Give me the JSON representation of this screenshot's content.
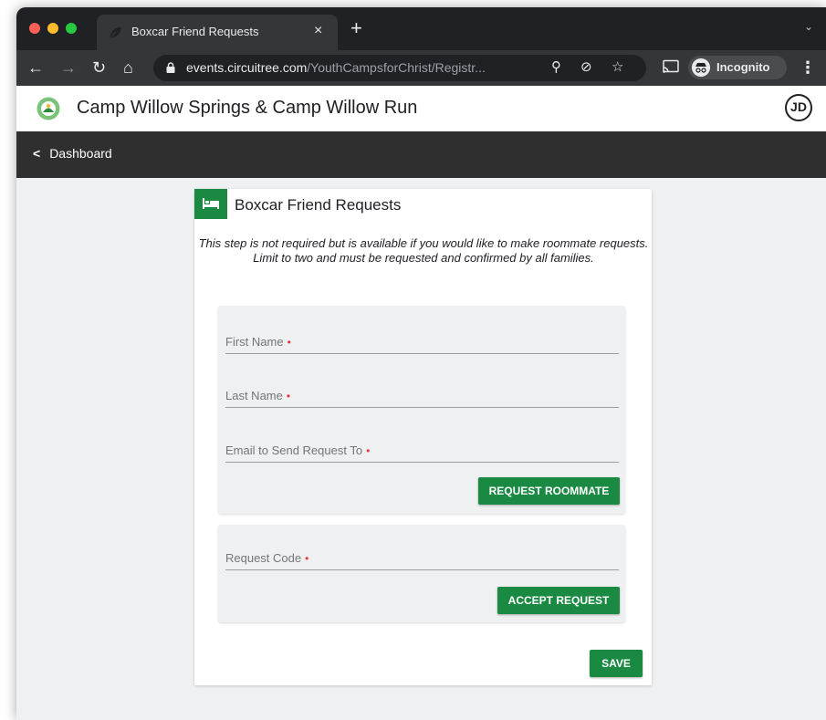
{
  "browser": {
    "tab_title": "Boxcar Friend Requests",
    "tab_close": "×",
    "new_tab": "+",
    "tab_search": "⌄",
    "url_host": "events.circuitree.com",
    "url_path": "/YouthCampsforChrist/Registr...",
    "incognito_label": "Incognito"
  },
  "app": {
    "title": "Camp Willow Springs & Camp Willow Run",
    "avatar_initials": "JD",
    "back_label": "Dashboard"
  },
  "card": {
    "title": "Boxcar Friend Requests",
    "description": "This step is not required but is available if you would like to make roommate requests. Limit to two and must be requested and confirmed by all families.",
    "fields": {
      "first_name": "First Name",
      "last_name": "Last Name",
      "email": "Email to Send Request To",
      "request_code": "Request Code"
    },
    "required_marker": "•",
    "request_button": "REQUEST ROOMMATE",
    "accept_button": "ACCEPT REQUEST",
    "save_button": "SAVE"
  },
  "colors": {
    "accent": "#1a8a43",
    "required": "#e53935",
    "nav_bg": "#2f2f2f",
    "page_bg": "#eef0f2"
  },
  "icons": {
    "tab_favicon": "leaf-icon",
    "card_icon": "bed-icon",
    "logo": "camp-logo-icon"
  }
}
